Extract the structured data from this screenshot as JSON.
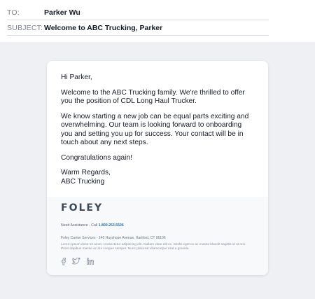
{
  "header": {
    "to_label": "TO:",
    "to_value": "Parker Wu",
    "subject_label": "SUBJECT:",
    "subject_value": "Welcome to ABC Trucking, Parker"
  },
  "email": {
    "greeting": "Hi Parker,",
    "para1": "Welcome to the ABC Trucking family. We're thrilled to offer you the position of CDL Long Haul Trucker.",
    "para2": "We know starting a new job can be equal parts exciting and overwhelming. Our team is looking forward to onboarding you and setting you up for success. Your contact will be in touch about any next steps.",
    "para3": "Congratulations again!",
    "closing": "Warm Regards,",
    "signature": "ABC Trucking"
  },
  "footer": {
    "logo_text": "FOLEY",
    "assist_label": "Need Assistance - Call ",
    "assist_phone": "1.800.253.5506",
    "address": "Foley Carrier Services - 140 Huyshope Avenue, Hartford, CT 06106",
    "lorem": "Lorem ipsum dolor sit amet, consectetur adipiscing elit. Nullam vitae elit ex. Morbi eget ex ac massa blandit sagittis id ut orci. Proin dapibus massa ac dui congue semper. Nunc placerat ullamcorper erat a gravida.",
    "social_icons": [
      "facebook-icon",
      "twitter-icon",
      "linkedin-icon"
    ]
  },
  "colors": {
    "accent": "#2e8bc9",
    "logo": "#3f4a57",
    "link": "#1f6fb2",
    "background": "#eef0f4"
  }
}
